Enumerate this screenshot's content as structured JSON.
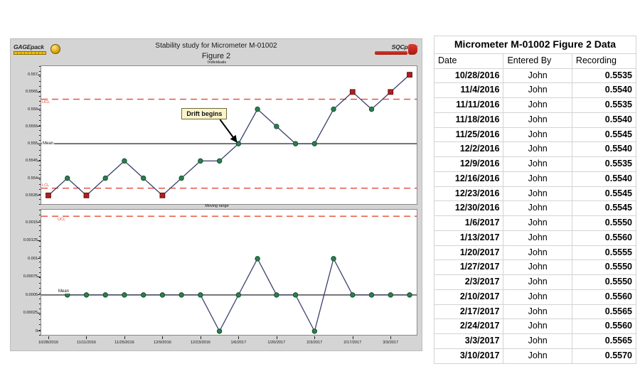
{
  "chart_panel": {
    "title": "Stability study for Micrometer M-01002",
    "subtitle": "Figure 2",
    "individuals_caption": "Individuals",
    "moving_range_caption": "Moving range",
    "gagepack_logo": "GAGEpack",
    "sqcpack_logo": "SQCpack",
    "annotation": "Drift begins",
    "ucl_label": "UCL",
    "lcl_label": "LCL",
    "mean_label": "Mean"
  },
  "table": {
    "title": "Micrometer M-01002 Figure 2 Data",
    "columns": [
      "Date",
      "Entered By",
      "Recording"
    ],
    "rows": [
      [
        "10/28/2016",
        "John",
        "0.5535"
      ],
      [
        "11/4/2016",
        "John",
        "0.5540"
      ],
      [
        "11/11/2016",
        "John",
        "0.5535"
      ],
      [
        "11/18/2016",
        "John",
        "0.5540"
      ],
      [
        "11/25/2016",
        "John",
        "0.5545"
      ],
      [
        "12/2/2016",
        "John",
        "0.5540"
      ],
      [
        "12/9/2016",
        "John",
        "0.5535"
      ],
      [
        "12/16/2016",
        "John",
        "0.5540"
      ],
      [
        "12/23/2016",
        "John",
        "0.5545"
      ],
      [
        "12/30/2016",
        "John",
        "0.5545"
      ],
      [
        "1/6/2017",
        "John",
        "0.5550"
      ],
      [
        "1/13/2017",
        "John",
        "0.5560"
      ],
      [
        "1/20/2017",
        "John",
        "0.5555"
      ],
      [
        "1/27/2017",
        "John",
        "0.5550"
      ],
      [
        "2/3/2017",
        "John",
        "0.5550"
      ],
      [
        "2/10/2017",
        "John",
        "0.5560"
      ],
      [
        "2/17/2017",
        "John",
        "0.5565"
      ],
      [
        "2/24/2017",
        "John",
        "0.5560"
      ],
      [
        "3/3/2017",
        "John",
        "0.5565"
      ],
      [
        "3/10/2017",
        "John",
        "0.5570"
      ]
    ]
  },
  "chart_data": [
    {
      "type": "line",
      "name": "individuals",
      "title": "Stability study for Micrometer M-01002",
      "subtitle": "Figure 2",
      "caption": "Individuals",
      "xlabel": "",
      "ylabel": "",
      "x": [
        "10/28/2016",
        "11/4/2016",
        "11/11/2016",
        "11/18/2016",
        "11/25/2016",
        "12/2/2016",
        "12/9/2016",
        "12/16/2016",
        "12/23/2016",
        "12/30/2016",
        "1/6/2017",
        "1/13/2017",
        "1/20/2017",
        "1/27/2017",
        "2/3/2017",
        "2/10/2017",
        "2/17/2017",
        "2/24/2017",
        "3/3/2017",
        "3/10/2017"
      ],
      "values": [
        0.5535,
        0.554,
        0.5535,
        0.554,
        0.5545,
        0.554,
        0.5535,
        0.554,
        0.5545,
        0.5545,
        0.555,
        0.556,
        0.5555,
        0.555,
        0.555,
        0.556,
        0.5565,
        0.556,
        0.5565,
        0.557
      ],
      "point_status": [
        "violation",
        "ok",
        "violation",
        "ok",
        "ok",
        "ok",
        "violation",
        "ok",
        "ok",
        "ok",
        "ok",
        "ok",
        "ok",
        "ok",
        "ok",
        "ok",
        "violation",
        "ok",
        "violation",
        "violation"
      ],
      "ylim": [
        0.55325,
        0.55725
      ],
      "yticks": [
        0.557,
        0.5565,
        0.556,
        0.5555,
        0.555,
        0.5545,
        0.554,
        0.5535
      ],
      "ytick_labels": [
        "0.557",
        "0.5565",
        "0.556",
        "0.5555",
        "0.555",
        "0.5545",
        "0.554",
        "0.5535"
      ],
      "mean": 0.555,
      "ucl": 0.55629,
      "lcl": 0.55371,
      "mean_label": "Mean",
      "ucl_label": "UCL",
      "lcl_label": "LCL",
      "annotations": [
        {
          "text": "Drift begins",
          "points_to_x": "1/6/2017",
          "points_to_y": 0.555
        }
      ],
      "grid": false,
      "legend": "none",
      "series_color": "#2e7d4f",
      "violation_color": "#b01f1f",
      "line_color": "#3a3f6b",
      "limit_color": "#e2493a"
    },
    {
      "type": "line",
      "name": "moving-range",
      "caption": "Moving range",
      "xlabel": "",
      "ylabel": "",
      "x": [
        "11/4/2016",
        "11/11/2016",
        "11/18/2016",
        "11/25/2016",
        "12/2/2016",
        "12/9/2016",
        "12/16/2016",
        "12/23/2016",
        "12/30/2016",
        "1/6/2017",
        "1/13/2017",
        "1/20/2017",
        "1/27/2017",
        "2/3/2017",
        "2/10/2017",
        "2/17/2017",
        "2/24/2017",
        "3/3/2017",
        "3/10/2017"
      ],
      "values": [
        0.0005,
        0.0005,
        0.0005,
        0.0005,
        0.0005,
        0.0005,
        0.0005,
        0.0005,
        0.0,
        0.0005,
        0.001,
        0.0005,
        0.0005,
        0.0,
        0.001,
        0.0005,
        0.0005,
        0.0005,
        0.0005
      ],
      "ylim": [
        -5e-05,
        0.001675
      ],
      "yticks": [
        0.0015,
        0.00125,
        0.001,
        0.00075,
        0.0005,
        0.00025,
        0
      ],
      "ytick_labels": [
        "0.0015",
        "0.00125",
        "0.001",
        "0.00075",
        "0.0005",
        "0.00025",
        "0"
      ],
      "mean": 0.0005,
      "ucl": 0.001585,
      "mean_label": "Mean",
      "ucl_label": "UCL",
      "grid": false,
      "legend": "none",
      "series_color": "#2e7d4f",
      "line_color": "#3a3f6b",
      "limit_color": "#e2493a"
    }
  ],
  "x_axis_tick_labels": [
    "10/28/2016",
    "11/11/2016",
    "11/25/2016",
    "12/9/2016",
    "12/23/2016",
    "1/6/2017",
    "1/20/2017",
    "2/3/2017",
    "2/17/2017",
    "3/3/2017"
  ]
}
